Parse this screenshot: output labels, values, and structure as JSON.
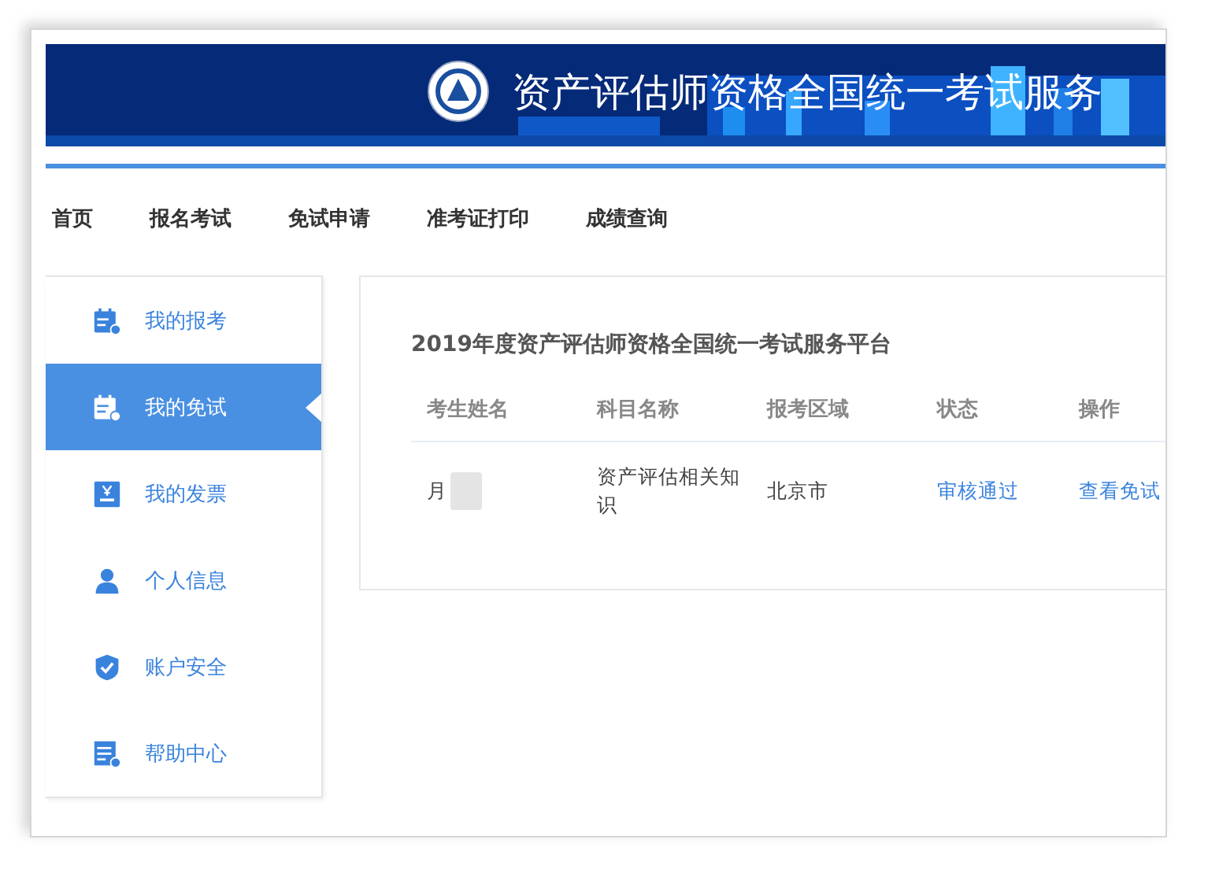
{
  "banner": {
    "title": "资产评估师资格全国统一考试服务"
  },
  "nav": [
    {
      "label": "首页"
    },
    {
      "label": "报名考试"
    },
    {
      "label": "免试申请"
    },
    {
      "label": "准考证打印"
    },
    {
      "label": "成绩查询"
    }
  ],
  "sidebar": {
    "items": [
      {
        "label": "我的报考",
        "selected": false
      },
      {
        "label": "我的免试",
        "selected": true
      },
      {
        "label": "我的发票",
        "selected": false
      },
      {
        "label": "个人信息",
        "selected": false
      },
      {
        "label": "账户安全",
        "selected": false
      },
      {
        "label": "帮助中心",
        "selected": false
      }
    ]
  },
  "panel": {
    "title": "2019年度资产评估师资格全国统一考试服务平台",
    "table": {
      "columns": [
        "考生姓名",
        "科目名称",
        "报考区域",
        "状态",
        "操作"
      ],
      "rows": [
        {
          "name": "月",
          "subject": "资产评估相关知识",
          "region": "北京市",
          "status": "审核通过",
          "action": "查看免试"
        }
      ]
    }
  }
}
